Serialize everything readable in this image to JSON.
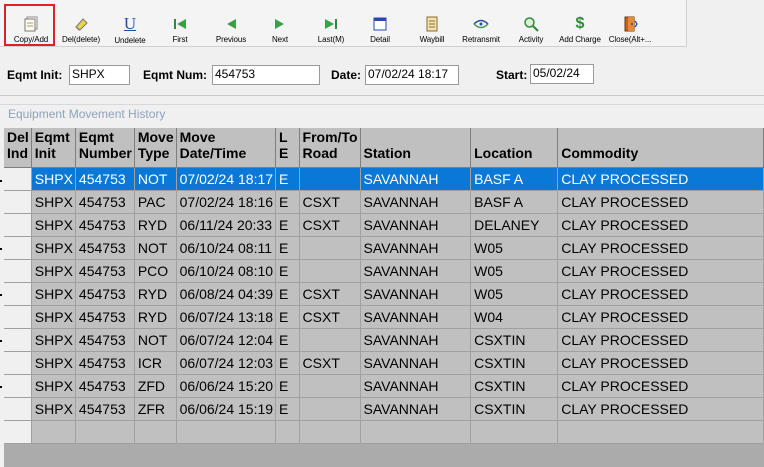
{
  "toolbar": {
    "buttons": [
      {
        "label": "Copy/Add",
        "icon": "copy-document-icon"
      },
      {
        "label": "Del(delete)",
        "icon": "eraser-icon"
      },
      {
        "label": "Undelete",
        "icon": "undelete-u-icon"
      },
      {
        "label": "First",
        "icon": "first-record-icon"
      },
      {
        "label": "Previous",
        "icon": "previous-record-icon"
      },
      {
        "label": "Next",
        "icon": "next-record-icon"
      },
      {
        "label": "Last(M)",
        "icon": "last-record-icon"
      },
      {
        "label": "Detail",
        "icon": "detail-window-icon"
      },
      {
        "label": "Waybill",
        "icon": "waybill-icon"
      },
      {
        "label": "Retransmit",
        "icon": "retransmit-icon"
      },
      {
        "label": "Activity",
        "icon": "activity-magnifier-icon"
      },
      {
        "label": "Add Charge",
        "icon": "dollar-icon"
      },
      {
        "label": "Close(Alt+...",
        "icon": "close-door-icon"
      }
    ]
  },
  "filters": {
    "eqmt_init_label": "Eqmt Init:",
    "eqmt_init_value": "SHPX",
    "eqmt_num_label": "Eqmt Num:",
    "eqmt_num_value": "454753",
    "date_label": "Date:",
    "date_value": "07/02/24 18:17",
    "start_label": "Start:",
    "start_value": "05/02/24"
  },
  "section_title": "Equipment Movement History",
  "grid": {
    "columns": [
      "Del Ind",
      "Eqmt Init",
      "Eqmt Number",
      "Move Type",
      "Move Date/Time",
      "L E",
      "From/To Road",
      "Station",
      "Location",
      "Commodity"
    ],
    "rows": [
      [
        "",
        "SHPX",
        "454753",
        "NOT",
        "07/02/24 18:17",
        "E",
        "",
        "SAVANNAH",
        "BASF A",
        "CLAY PROCESSED"
      ],
      [
        "",
        "SHPX",
        "454753",
        "PAC",
        "07/02/24 18:16",
        "E",
        "CSXT",
        "SAVANNAH",
        "BASF A",
        "CLAY PROCESSED"
      ],
      [
        "",
        "SHPX",
        "454753",
        "RYD",
        "06/11/24 20:33",
        "E",
        "CSXT",
        "SAVANNAH",
        "DELANEY",
        "CLAY PROCESSED"
      ],
      [
        "",
        "SHPX",
        "454753",
        "NOT",
        "06/10/24 08:11",
        "E",
        "",
        "SAVANNAH",
        "W05",
        "CLAY PROCESSED"
      ],
      [
        "",
        "SHPX",
        "454753",
        "PCO",
        "06/10/24 08:10",
        "E",
        "",
        "SAVANNAH",
        "W05",
        "CLAY PROCESSED"
      ],
      [
        "",
        "SHPX",
        "454753",
        "RYD",
        "06/08/24 04:39",
        "E",
        "CSXT",
        "SAVANNAH",
        "W05",
        "CLAY PROCESSED"
      ],
      [
        "",
        "SHPX",
        "454753",
        "RYD",
        "06/07/24 13:18",
        "E",
        "CSXT",
        "SAVANNAH",
        "W04",
        "CLAY PROCESSED"
      ],
      [
        "",
        "SHPX",
        "454753",
        "NOT",
        "06/07/24 12:04",
        "E",
        "",
        "SAVANNAH",
        "CSXTIN",
        "CLAY PROCESSED"
      ],
      [
        "",
        "SHPX",
        "454753",
        "ICR",
        "06/07/24 12:03",
        "E",
        "CSXT",
        "SAVANNAH",
        "CSXTIN",
        "CLAY PROCESSED"
      ],
      [
        "",
        "SHPX",
        "454753",
        "ZFD",
        "06/06/24 15:20",
        "E",
        "",
        "SAVANNAH",
        "CSXTIN",
        "CLAY PROCESSED"
      ],
      [
        "",
        "SHPX",
        "454753",
        "ZFR",
        "06/06/24 15:19",
        "E",
        "",
        "SAVANNAH",
        "CSXTIN",
        "CLAY PROCESSED"
      ],
      [
        "",
        "",
        "",
        "",
        "",
        "",
        "",
        "",
        "",
        ""
      ]
    ],
    "selected_row": 0
  },
  "colors": {
    "selection": "#0a78d7",
    "highlight_box": "#e0202a",
    "grid_bg": "#c0c0c0"
  }
}
